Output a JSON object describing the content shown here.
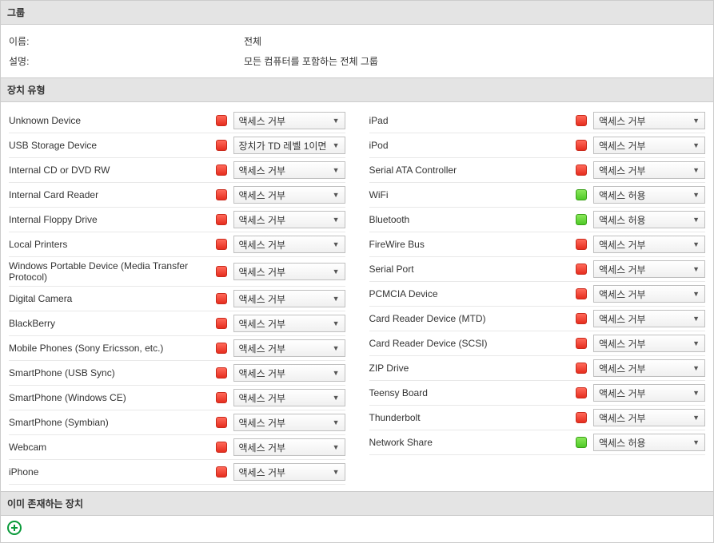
{
  "sections": {
    "group": {
      "title": "그룹",
      "name_label": "이름:",
      "name_value": "전체",
      "desc_label": "설명:",
      "desc_value": "모든 컴퓨터를 포함하는 전체 그룹"
    },
    "device_types": {
      "title": "장치 유형"
    },
    "existing": {
      "title": "이미 존재하는 장치"
    }
  },
  "options": {
    "deny": "액세스 거부",
    "allow": "액세스 허용",
    "td_level": "장치가 TD 레벨 1이면"
  },
  "left_devices": [
    {
      "label": "Unknown Device",
      "status": "red",
      "sel": "deny"
    },
    {
      "label": "USB Storage Device",
      "status": "red",
      "sel": "td_level"
    },
    {
      "label": "Internal CD or DVD RW",
      "status": "red",
      "sel": "deny"
    },
    {
      "label": "Internal Card Reader",
      "status": "red",
      "sel": "deny"
    },
    {
      "label": "Internal Floppy Drive",
      "status": "red",
      "sel": "deny"
    },
    {
      "label": "Local Printers",
      "status": "red",
      "sel": "deny"
    },
    {
      "label": "Windows Portable Device (Media Transfer Protocol)",
      "status": "red",
      "sel": "deny"
    },
    {
      "label": "Digital Camera",
      "status": "red",
      "sel": "deny"
    },
    {
      "label": "BlackBerry",
      "status": "red",
      "sel": "deny"
    },
    {
      "label": "Mobile Phones (Sony Ericsson, etc.)",
      "status": "red",
      "sel": "deny"
    },
    {
      "label": "SmartPhone (USB Sync)",
      "status": "red",
      "sel": "deny"
    },
    {
      "label": "SmartPhone (Windows CE)",
      "status": "red",
      "sel": "deny"
    },
    {
      "label": "SmartPhone (Symbian)",
      "status": "red",
      "sel": "deny"
    },
    {
      "label": "Webcam",
      "status": "red",
      "sel": "deny"
    },
    {
      "label": "iPhone",
      "status": "red",
      "sel": "deny"
    }
  ],
  "right_devices": [
    {
      "label": "iPad",
      "status": "red",
      "sel": "deny"
    },
    {
      "label": "iPod",
      "status": "red",
      "sel": "deny"
    },
    {
      "label": "Serial ATA Controller",
      "status": "red",
      "sel": "deny"
    },
    {
      "label": "WiFi",
      "status": "green",
      "sel": "allow"
    },
    {
      "label": "Bluetooth",
      "status": "green",
      "sel": "allow"
    },
    {
      "label": "FireWire Bus",
      "status": "red",
      "sel": "deny"
    },
    {
      "label": "Serial Port",
      "status": "red",
      "sel": "deny"
    },
    {
      "label": "PCMCIA Device",
      "status": "red",
      "sel": "deny"
    },
    {
      "label": "Card Reader Device (MTD)",
      "status": "red",
      "sel": "deny"
    },
    {
      "label": "Card Reader Device (SCSI)",
      "status": "red",
      "sel": "deny"
    },
    {
      "label": "ZIP Drive",
      "status": "red",
      "sel": "deny"
    },
    {
      "label": "Teensy Board",
      "status": "red",
      "sel": "deny"
    },
    {
      "label": "Thunderbolt",
      "status": "red",
      "sel": "deny"
    },
    {
      "label": "Network Share",
      "status": "green",
      "sel": "allow"
    }
  ]
}
